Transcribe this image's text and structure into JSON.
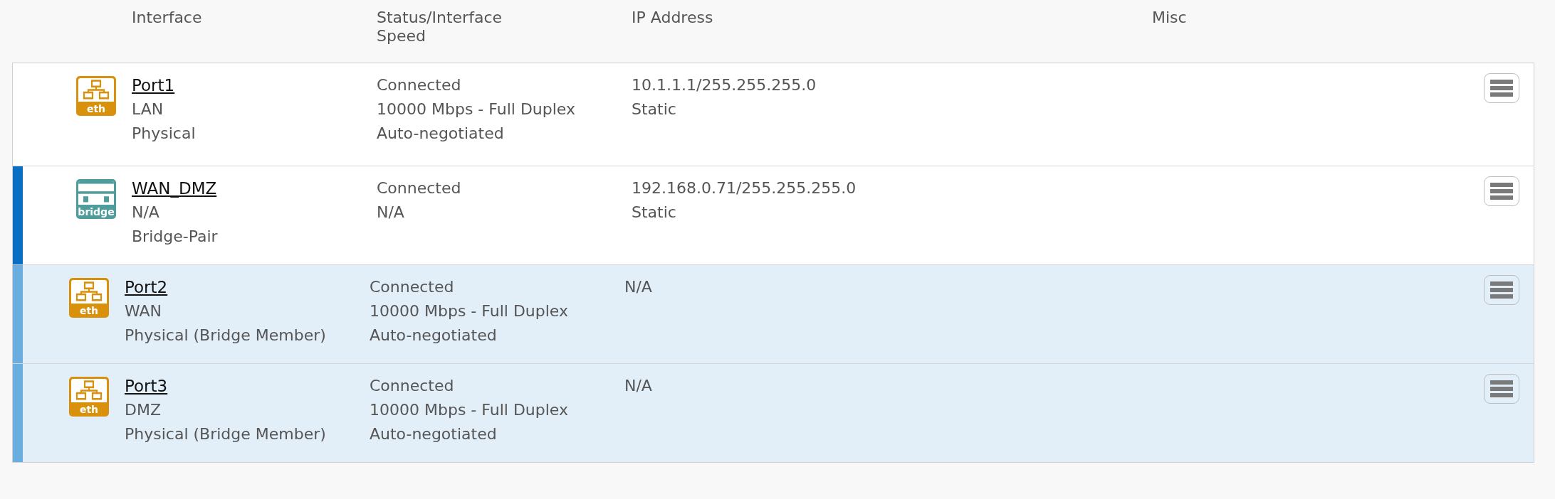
{
  "table": {
    "columns": [
      "Interface",
      "Status/Interface Speed",
      "IP Address",
      "Misc"
    ],
    "rows": [
      {
        "kind": "plain",
        "icon": {
          "kind": "eth",
          "label": "eth"
        },
        "name": "Port1",
        "zone": "LAN",
        "type": "Physical",
        "status": [
          "Connected",
          "10000 Mbps - Full Duplex",
          "Auto-negotiated"
        ],
        "ip": [
          "10.1.1.1/255.255.255.0",
          "Static"
        ]
      },
      {
        "kind": "bridge",
        "icon": {
          "kind": "bridge",
          "label": "bridge"
        },
        "name": "WAN_DMZ",
        "zone": "N/A",
        "type": "Bridge-Pair",
        "status": [
          "Connected",
          "N/A"
        ],
        "ip": [
          "192.168.0.71/255.255.255.0",
          "Static"
        ]
      },
      {
        "kind": "member",
        "icon": {
          "kind": "eth",
          "label": "eth"
        },
        "name": "Port2",
        "zone": "WAN",
        "type": "Physical (Bridge Member)",
        "status": [
          "Connected",
          "10000 Mbps - Full Duplex",
          "Auto-negotiated"
        ],
        "ip": [
          "N/A"
        ]
      },
      {
        "kind": "member",
        "icon": {
          "kind": "eth",
          "label": "eth"
        },
        "name": "Port3",
        "zone": "DMZ",
        "type": "Physical (Bridge Member)",
        "status": [
          "Connected",
          "10000 Mbps - Full Duplex",
          "Auto-negotiated"
        ],
        "ip": [
          "N/A"
        ]
      }
    ]
  }
}
